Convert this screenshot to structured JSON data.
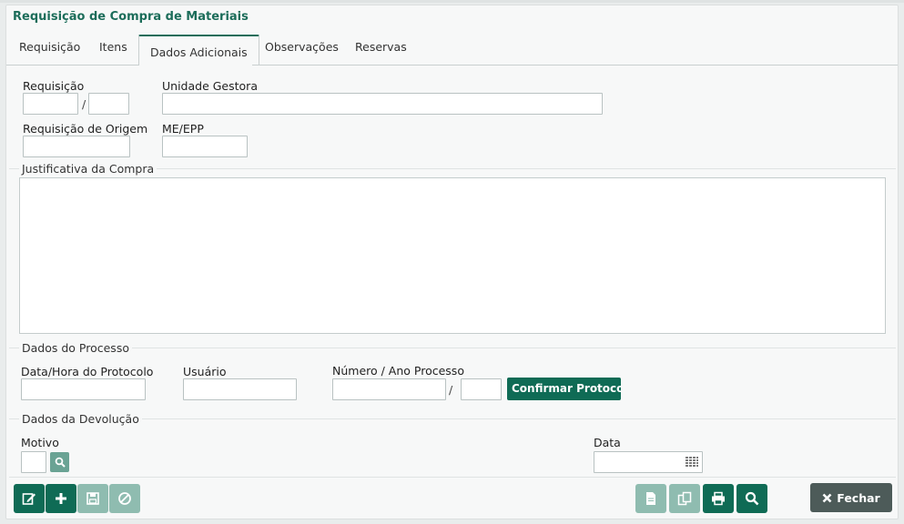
{
  "window": {
    "title": "Requisição de Compra de Materiais"
  },
  "tabs": [
    {
      "label": "Requisição"
    },
    {
      "label": "Itens"
    },
    {
      "label": "Dados Adicionais",
      "active": true
    },
    {
      "label": "Observações"
    },
    {
      "label": "Reservas"
    }
  ],
  "form": {
    "requisicao_label": "Requisição",
    "requisicao_number": "",
    "requisicao_year": "",
    "slash": "/",
    "unidade_gestora_label": "Unidade Gestora",
    "unidade_gestora_value": "",
    "requisicao_origem_label": "Requisição de Origem",
    "requisicao_origem_value": "",
    "me_epp_label": "ME/EPP",
    "me_epp_value": "",
    "justificativa_label": "Justificativa da Compra",
    "justificativa_value": ""
  },
  "processo": {
    "legend": "Dados do Processo",
    "data_hora_label": "Data/Hora do Protocolo",
    "data_hora_value": "",
    "usuario_label": "Usuário",
    "usuario_value": "",
    "numero_ano_label": "Número / Ano Processo",
    "numero_value": "",
    "ano_value": "",
    "confirmar_label": "Confirmar Protocolo"
  },
  "devolucao": {
    "legend": "Dados da Devolução",
    "motivo_label": "Motivo",
    "motivo_value": "",
    "data_label": "Data",
    "data_value": ""
  },
  "toolbar": {
    "close_label": "Fechar",
    "left_icons": [
      "edit-icon",
      "plus-icon",
      "save-icon",
      "cancel-icon"
    ],
    "right_icons": [
      "document-icon",
      "copy-icon",
      "print-icon",
      "search-icon"
    ]
  },
  "colors": {
    "accent": "#0f6b55",
    "accent_disabled": "#8fbcb0",
    "close": "#4d5b59"
  }
}
